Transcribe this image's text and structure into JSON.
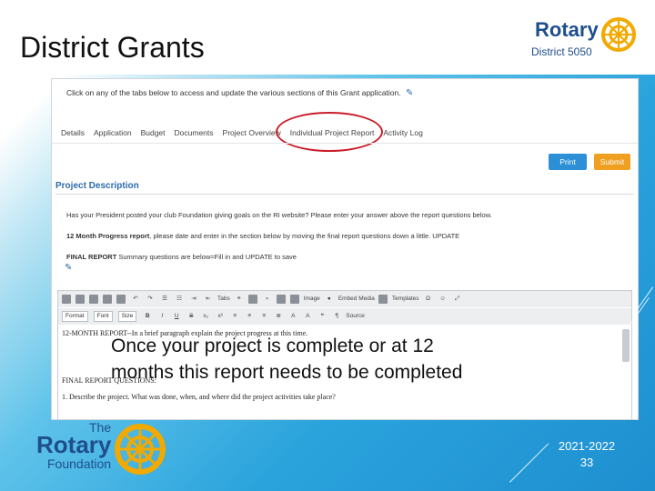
{
  "slide": {
    "title": "District Grants",
    "overlay_line1": "Once your project is complete or at 12",
    "overlay_line2": "months this report needs to be completed",
    "year": "2021-2022",
    "page_number": "33"
  },
  "logos": {
    "rotary_word": "Rotary",
    "district_text": "District 5050",
    "foundation_the": "The",
    "foundation_rotary": "Rotary",
    "foundation_word": "Foundation"
  },
  "app": {
    "instruction": "Click on any of the tabs below to access and update the various sections of this Grant application.",
    "tabs": [
      {
        "label": "Details"
      },
      {
        "label": "Application"
      },
      {
        "label": "Budget"
      },
      {
        "label": "Documents"
      },
      {
        "label": "Project Overview"
      },
      {
        "label": "Individual Project Report"
      },
      {
        "label": "Activity Log"
      }
    ],
    "print_label": "Print",
    "submit_label": "Submit",
    "section_title": "Project Description",
    "question1": "Has your President posted your club Foundation giving goals on the RI website? Please enter your answer above the report questions below.",
    "question2_bold": "12 Month Progress report",
    "question2_rest": ", please date and enter in the section below by moving the final report questions down a little. UPDATE",
    "question3_bold": "FINAL REPORT",
    "question3_rest": " Summary questions are below=Fill in and UPDATE to save",
    "editor": {
      "toolbar1_labels": [
        "Tabs",
        "Image",
        "Embed Media",
        "Templates"
      ],
      "format_select": "Format",
      "font_select": "Font",
      "size_select": "Size",
      "source_label": "Source",
      "body_line1": "12-MONTH REPORT--In a brief paragraph explain the project progress at this time.",
      "body_line2": "FINAL REPORT QUESTIONS:",
      "body_line3": "1. Describe the project. What was done, when, and where did the project activities take place?"
    }
  },
  "colors": {
    "accent_blue": "#2b6cae",
    "print_button": "#2d8fd6",
    "submit_button": "#f0a020",
    "highlight_oval": "#c81e2a",
    "rotary_blue": "#1f4e8c",
    "rotary_gold": "#f2a900"
  }
}
